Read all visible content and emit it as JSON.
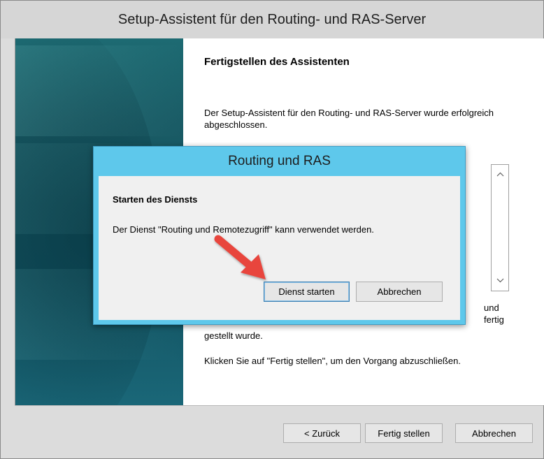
{
  "window": {
    "title": "Setup-Assistent für den Routing- und RAS-Server"
  },
  "wizard": {
    "heading": "Fertigstellen des Assistenten",
    "intro": "Der Setup-Assistent für den Routing- und RAS-Server wurde erfolgreich abgeschlossen.",
    "obscured_right_1": "und",
    "obscured_right_2": "fertig",
    "obscured_line": "gestellt wurde.",
    "instruction": "Klicken Sie auf \"Fertig stellen\", um den Vorgang abzuschließen."
  },
  "footer": {
    "back_label": "< Zurück",
    "finish_label": "Fertig stellen",
    "cancel_label": "Abbrechen"
  },
  "dialog": {
    "title": "Routing und RAS",
    "heading": "Starten des Diensts",
    "message": "Der Dienst \"Routing und Remotezugriff\" kann verwendet werden.",
    "start_label": "Dienst starten",
    "cancel_label": "Abbrechen"
  },
  "colors": {
    "dialog_frame": "#5ec8eb",
    "side_panel": "#14525e",
    "arrow": "#e8453c"
  },
  "icons": {
    "scroll_up": "chevron-up-icon",
    "scroll_down": "chevron-down-icon",
    "pointer": "red-arrow-icon"
  }
}
